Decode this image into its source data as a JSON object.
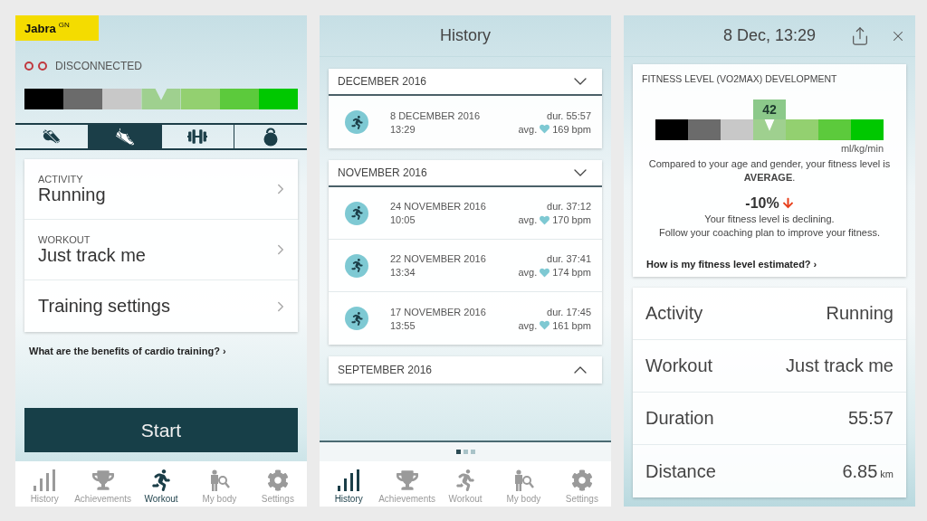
{
  "screens": [
    {
      "kind": "workout",
      "logo": {
        "name": "Jabra",
        "mark": "GN"
      },
      "status": "DISCONNECTED",
      "scale": [
        {
          "color": "#000000",
          "selected": false
        },
        {
          "color": "#6b6b6b",
          "selected": false
        },
        {
          "color": "#c8c8c8",
          "selected": false
        },
        {
          "color": "#9fd08f",
          "selected": true
        },
        {
          "color": "#93d070",
          "selected": false
        },
        {
          "color": "#5cca3c",
          "selected": false
        },
        {
          "color": "#00c800",
          "selected": false
        }
      ],
      "sport_tabs": [
        {
          "kind": "whistle",
          "selected": false
        },
        {
          "kind": "shoe",
          "selected": true
        },
        {
          "kind": "dumbbell",
          "selected": false
        },
        {
          "kind": "kettlebell",
          "selected": false
        }
      ],
      "settings": [
        {
          "label": "ACTIVITY",
          "value": "Running"
        },
        {
          "label": "WORKOUT",
          "value": "Just track me"
        },
        {
          "value": "Training settings"
        }
      ],
      "link": "What are the benefits of cardio training? ›",
      "start_button": "Start",
      "nav": [
        {
          "kind": "history",
          "label": "History",
          "selected": false
        },
        {
          "kind": "achievements",
          "label": "Achievements",
          "selected": false
        },
        {
          "kind": "workout",
          "label": "Workout",
          "selected": true
        },
        {
          "kind": "body",
          "label": "My body",
          "selected": false
        },
        {
          "kind": "settings",
          "label": "Settings",
          "selected": false
        }
      ]
    },
    {
      "kind": "history",
      "title": "History",
      "groups": [
        {
          "month": "DECEMBER 2016",
          "expanded": true,
          "entries": [
            {
              "date": "8 DECEMBER 2016",
              "time": "13:29",
              "duration": "dur. 55:57",
              "avg_label": "avg.",
              "heart_rate": "169 bpm"
            }
          ]
        },
        {
          "month": "NOVEMBER 2016",
          "expanded": true,
          "entries": [
            {
              "date": "24 NOVEMBER 2016",
              "time": "10:05",
              "duration": "dur. 37:12",
              "avg_label": "avg.",
              "heart_rate": "170 bpm"
            },
            {
              "date": "22 NOVEMBER 2016",
              "time": "13:34",
              "duration": "dur. 37:41",
              "avg_label": "avg.",
              "heart_rate": "174 bpm"
            },
            {
              "date": "17 NOVEMBER 2016",
              "time": "13:55",
              "duration": "dur. 17:45",
              "avg_label": "avg.",
              "heart_rate": "161 bpm"
            }
          ]
        },
        {
          "month": "SEPTEMBER 2016",
          "expanded": false
        }
      ],
      "page_dots": [
        {
          "selected": true
        },
        {
          "selected": false
        },
        {
          "selected": false
        }
      ],
      "nav": [
        {
          "kind": "history",
          "label": "History",
          "selected": true
        },
        {
          "kind": "achievements",
          "label": "Achievements",
          "selected": false
        },
        {
          "kind": "workout",
          "label": "Workout",
          "selected": false
        },
        {
          "kind": "body",
          "label": "My body",
          "selected": false
        },
        {
          "kind": "settings",
          "label": "Settings",
          "selected": false
        }
      ]
    },
    {
      "kind": "details",
      "title": "8 Dec, 13:29",
      "fitness": {
        "heading": "FITNESS LEVEL (VO2MAX) DEVELOPMENT",
        "reading": "42",
        "scale": [
          {
            "color": "#000000",
            "selected": false
          },
          {
            "color": "#6b6b6b",
            "selected": false
          },
          {
            "color": "#c8c8c8",
            "selected": false
          },
          {
            "color": "#9fd08f",
            "selected": true
          },
          {
            "color": "#93d070",
            "selected": false
          },
          {
            "color": "#5cca3c",
            "selected": false
          },
          {
            "color": "#00c800",
            "selected": false
          }
        ],
        "unit": "ml/kg/min",
        "summary": "Compared to your age and gender, your fitness level is **AVERAGE**.",
        "change": "-10%",
        "message": [
          "Your fitness level is declining.",
          "Follow your coaching plan to improve your fitness."
        ],
        "link": "How is my fitness level estimated? ›"
      },
      "details": [
        {
          "label": "Activity",
          "value": "Running"
        },
        {
          "label": "Workout",
          "value": "Just track me"
        },
        {
          "label": "Duration",
          "value": "55:57"
        },
        {
          "label": "Distance",
          "value": "6.85",
          "unit": "km"
        }
      ]
    }
  ]
}
